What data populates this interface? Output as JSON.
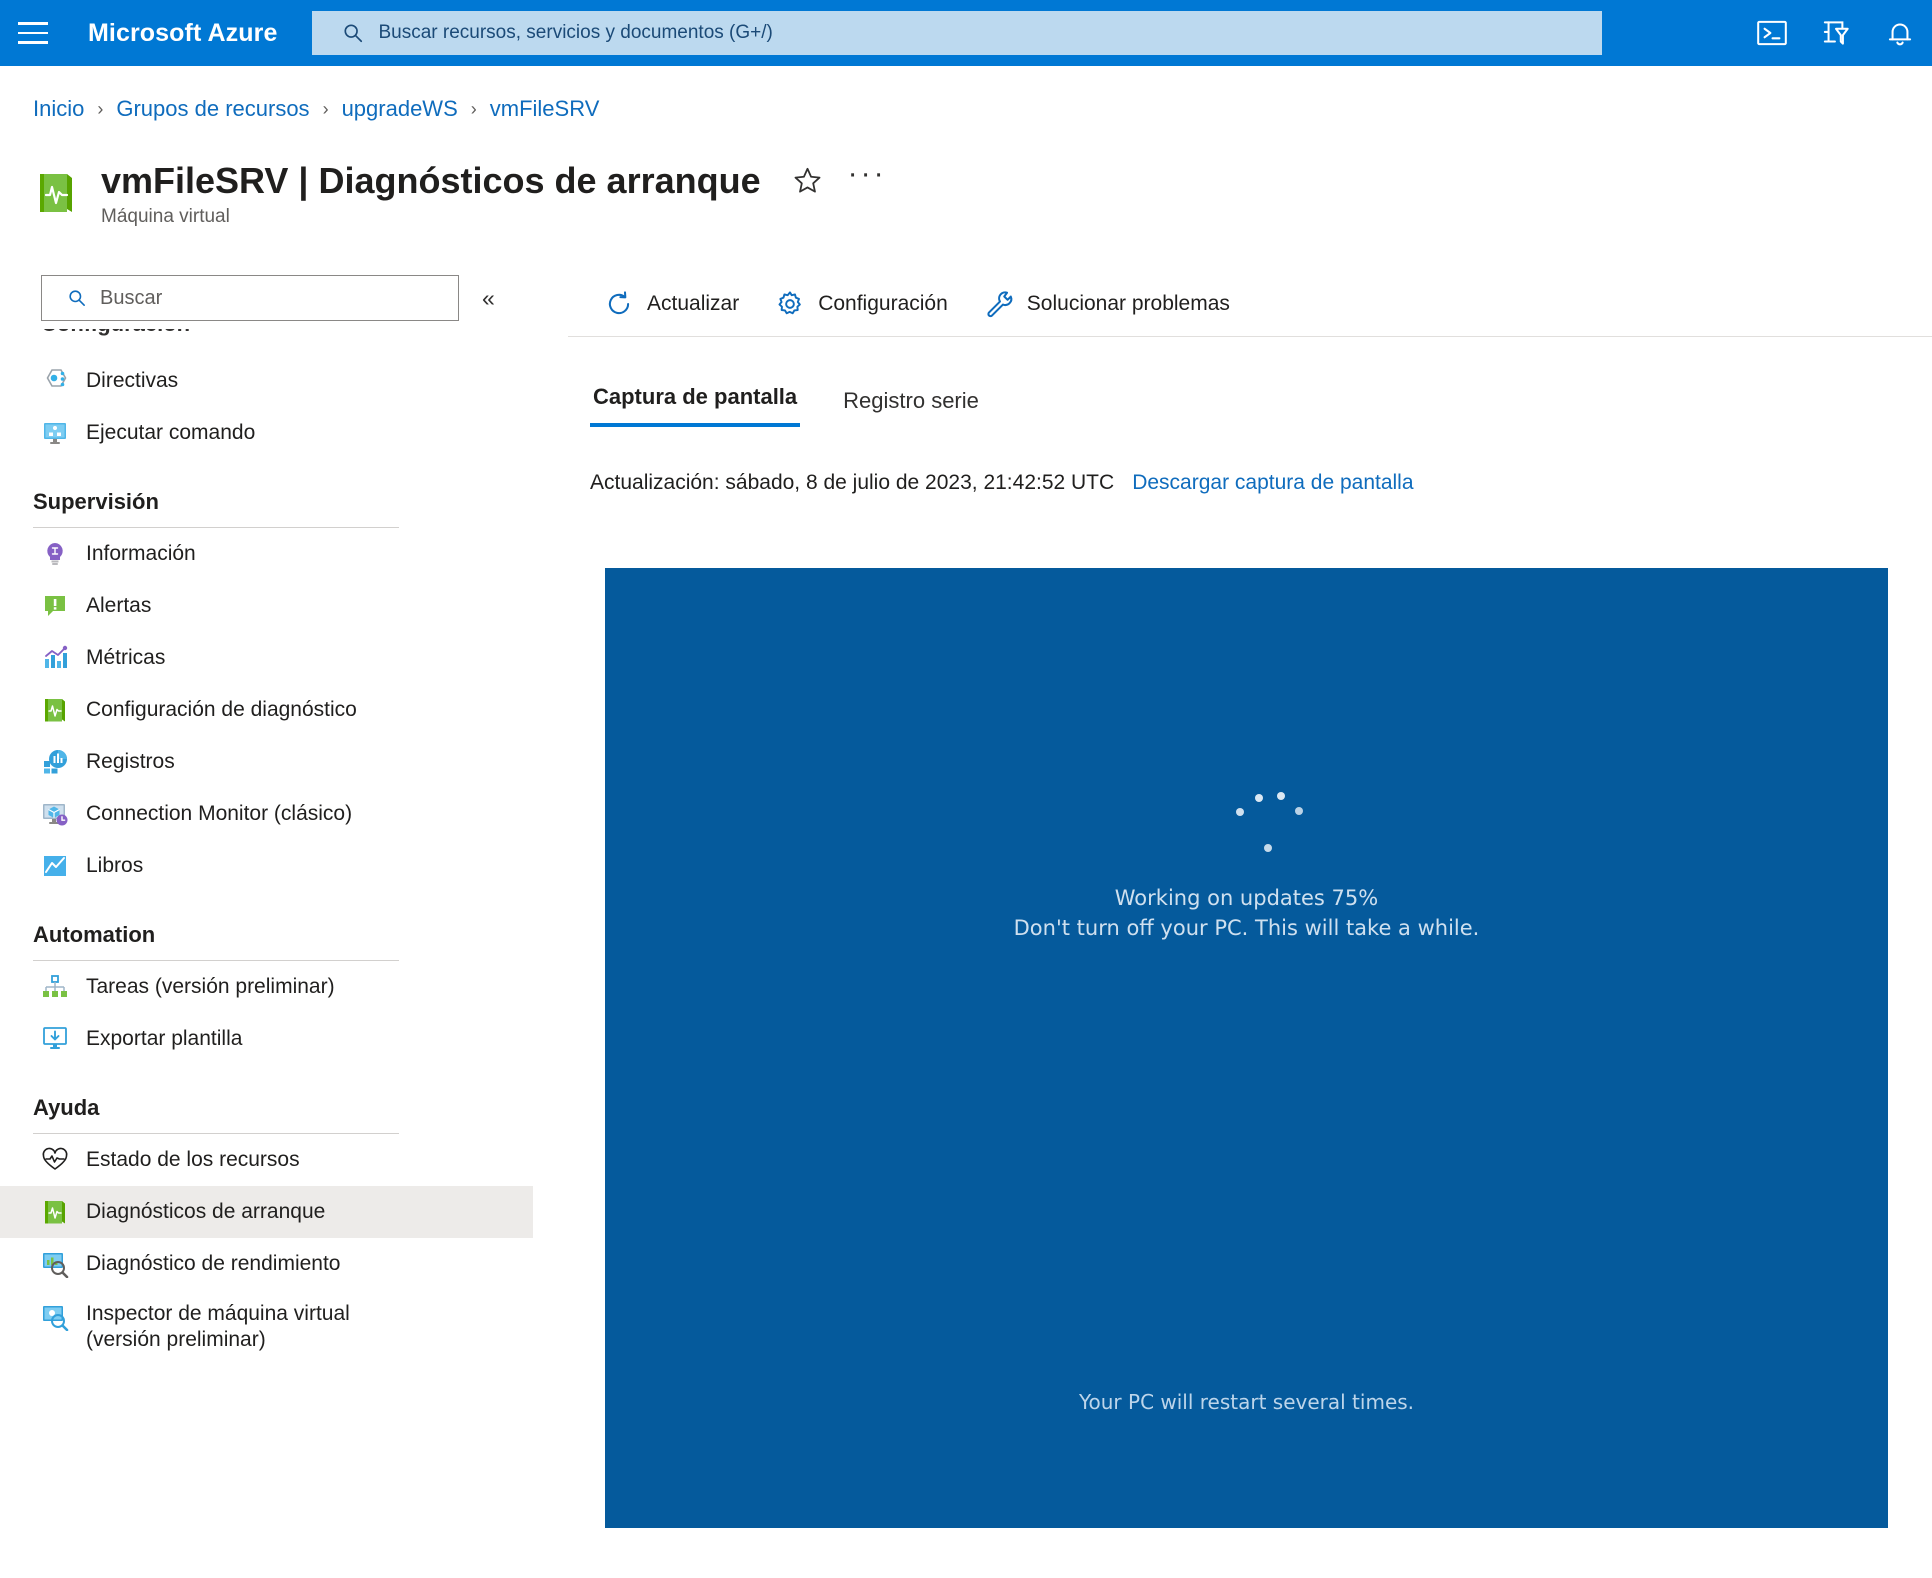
{
  "topbar": {
    "menu_icon": "hamburger-icon",
    "brand": "Microsoft Azure",
    "search_placeholder": "Buscar recursos, servicios y documentos (G+/)",
    "search_icon": "search-icon",
    "icons": [
      {
        "name": "cloud-shell-icon"
      },
      {
        "name": "directories-subscriptions-icon"
      },
      {
        "name": "notifications-bell-icon"
      }
    ],
    "accent_color": "#0078d4",
    "search_bg": "#bcd9ef"
  },
  "breadcrumb": {
    "items": [
      {
        "label": "Inicio"
      },
      {
        "label": "Grupos de recursos"
      },
      {
        "label": "upgradeWS"
      },
      {
        "label": "vmFileSRV"
      }
    ],
    "separator": "›",
    "link_color": "#0f6cbd"
  },
  "header": {
    "icon": "virtual-machine-diagnostics-icon",
    "title": "vmFileSRV | Diagnósticos de arranque",
    "subtitle": "Máquina virtual",
    "favorite_icon": "star-outline-icon",
    "more_icon": "ellipsis-icon",
    "more_label": "···"
  },
  "sidebar": {
    "search_placeholder": "Buscar",
    "search_icon": "search-icon",
    "collapse_icon": "double-chevron-left-icon",
    "collapse_label": "«",
    "clipped_label": "Configuración",
    "top_items": [
      {
        "label": "Directivas",
        "icon": "policy-icon"
      },
      {
        "label": "Ejecutar comando",
        "icon": "run-command-icon"
      }
    ],
    "sections": [
      {
        "title": "Supervisión",
        "items": [
          {
            "label": "Información",
            "icon": "insights-lightbulb-icon"
          },
          {
            "label": "Alertas",
            "icon": "alerts-icon"
          },
          {
            "label": "Métricas",
            "icon": "metrics-chart-icon"
          },
          {
            "label": "Configuración de diagnóstico",
            "icon": "diagnostic-settings-icon"
          },
          {
            "label": "Registros",
            "icon": "logs-icon"
          },
          {
            "label": "Connection Monitor (clásico)",
            "icon": "connection-monitor-icon"
          },
          {
            "label": "Libros",
            "icon": "workbooks-icon"
          }
        ]
      },
      {
        "title": "Automation",
        "items": [
          {
            "label": "Tareas (versión preliminar)",
            "icon": "tasks-icon"
          },
          {
            "label": "Exportar plantilla",
            "icon": "export-template-icon"
          }
        ]
      },
      {
        "title": "Ayuda",
        "items": [
          {
            "label": "Estado de los recursos",
            "icon": "resource-health-icon"
          },
          {
            "label": "Diagnósticos de arranque",
            "icon": "boot-diagnostics-icon",
            "selected": true
          },
          {
            "label": "Diagnóstico de rendimiento",
            "icon": "performance-diagnostics-icon"
          },
          {
            "label": "Inspector de máquina virtual",
            "label2": "(versión preliminar)",
            "icon": "vm-inspector-icon"
          }
        ]
      }
    ]
  },
  "toolbar": {
    "buttons": [
      {
        "label": "Actualizar",
        "icon": "refresh-icon"
      },
      {
        "label": "Configuración",
        "icon": "gear-icon"
      },
      {
        "label": "Solucionar problemas",
        "icon": "wrench-icon"
      }
    ]
  },
  "tabs": [
    {
      "label": "Captura de pantalla",
      "active": true
    },
    {
      "label": "Registro serie",
      "active": false
    }
  ],
  "status": {
    "updated_text": "Actualización: sábado, 8 de julio de 2023, 21:42:52 UTC",
    "download_link": "Descargar captura de pantalla"
  },
  "screenshot": {
    "background": "#055a9c",
    "updating_line1": "Working on updates  75%",
    "updating_line2": "Don't turn off your PC. This will take a while.",
    "restart_line": "Your PC will restart several times.",
    "progress_percent": 75
  }
}
